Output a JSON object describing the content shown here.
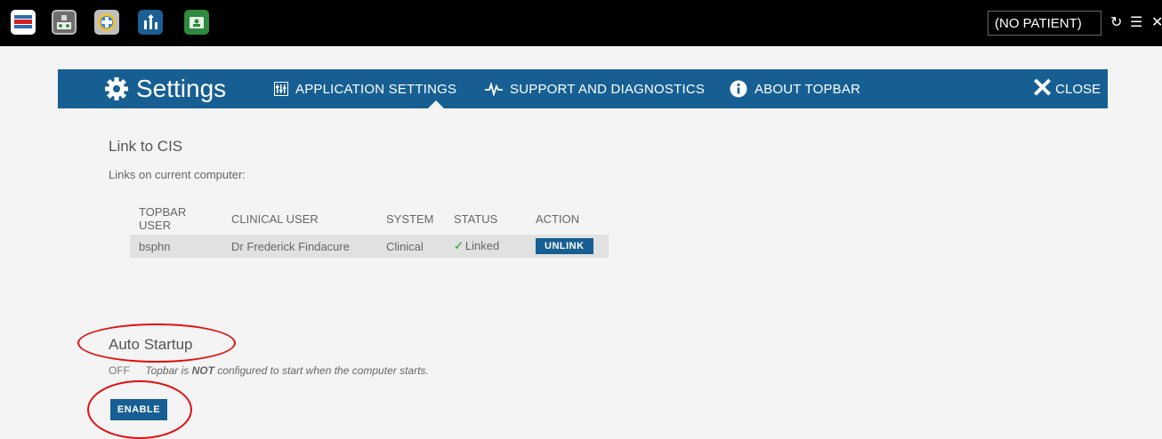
{
  "topbar": {
    "patient_label": "(NO PATIENT)",
    "icons": [
      "topbar-logo-icon",
      "clinic-icon",
      "clinical-badge-icon",
      "referral-arrows-icon",
      "patient-folder-icon"
    ],
    "refresh_glyph": "↻",
    "menu_glyph": "☰",
    "close_glyph": "✕"
  },
  "header": {
    "title": "Settings",
    "tabs": [
      {
        "label": "APPLICATION SETTINGS",
        "icon": "sliders-icon"
      },
      {
        "label": "SUPPORT AND DIAGNOSTICS",
        "icon": "pulse-icon"
      },
      {
        "label": "ABOUT TOPBAR",
        "icon": "info-icon"
      }
    ],
    "close_label": "CLOSE",
    "close_glyph": "✕"
  },
  "link_section": {
    "title": "Link to CIS",
    "subtitle": "Links on current computer:",
    "columns": [
      "TOPBAR USER",
      "CLINICAL USER",
      "SYSTEM",
      "STATUS",
      "ACTION"
    ],
    "rows": [
      {
        "topbar_user": "bsphn",
        "clinical_user": "Dr Frederick Findacure",
        "system": "Clinical",
        "status": "Linked",
        "action": "UNLINK"
      }
    ]
  },
  "auto_startup": {
    "title": "Auto Startup",
    "state": "OFF",
    "desc_before": "Topbar is ",
    "desc_emph": "NOT",
    "desc_after": " configured to start when the computer starts.",
    "button_label": "ENABLE"
  },
  "colors": {
    "header_bg": "#175f93",
    "annotation": "#e01010",
    "status_ok": "#4caf50"
  }
}
